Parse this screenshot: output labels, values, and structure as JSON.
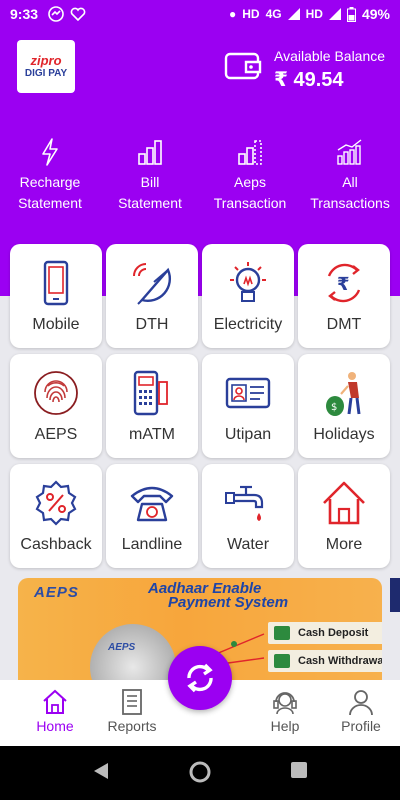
{
  "status_bar": {
    "time": "9:33",
    "network": "HD",
    "network2": "4G",
    "network3": "HD",
    "battery": "49%"
  },
  "header": {
    "logo_line1": "zipro",
    "logo_line2": "DIGI PAY",
    "balance_label": "Available Balance",
    "balance_amount": "₹ 49.54"
  },
  "quick_actions": [
    {
      "line1": "Recharge",
      "line2": "Statement",
      "icon": "bolt-icon"
    },
    {
      "line1": "Bill",
      "line2": "Statement",
      "icon": "bar-chart-icon"
    },
    {
      "line1": "Aeps",
      "line2": "Transaction",
      "icon": "bar-chart-icon"
    },
    {
      "line1": "All",
      "line2": "Transactions",
      "icon": "trend-chart-icon"
    }
  ],
  "services": [
    {
      "label": "Mobile",
      "icon": "mobile-icon"
    },
    {
      "label": "DTH",
      "icon": "satellite-dish-icon"
    },
    {
      "label": "Electricity",
      "icon": "bulb-icon"
    },
    {
      "label": "DMT",
      "icon": "rupee-transfer-icon"
    },
    {
      "label": "AEPS",
      "icon": "fingerprint-icon"
    },
    {
      "label": "mATM",
      "icon": "pos-machine-icon"
    },
    {
      "label": "Utipan",
      "icon": "id-card-icon"
    },
    {
      "label": "Holidays",
      "icon": "holidays-icon"
    },
    {
      "label": "Cashback",
      "icon": "percent-badge-icon"
    },
    {
      "label": "Landline",
      "icon": "telephone-icon"
    },
    {
      "label": "Water",
      "icon": "water-tap-icon"
    },
    {
      "label": "More",
      "icon": "house-icon"
    }
  ],
  "banner": {
    "logo": "AEPS",
    "title_line1": "Aadhaar Enable",
    "title_line2": "Payment System",
    "disc_label": "AEPS",
    "pills": [
      "Cash Deposit",
      "Cash Withdrawal"
    ]
  },
  "bottom_nav": [
    {
      "label": "Home",
      "icon": "home-icon",
      "active": true
    },
    {
      "label": "Reports",
      "icon": "reports-icon",
      "active": false
    },
    {
      "label": "Help",
      "icon": "headset-icon",
      "active": false
    },
    {
      "label": "Profile",
      "icon": "person-icon",
      "active": false
    }
  ],
  "colors": {
    "primary": "#9b00f2",
    "icon_blue": "#2a3f9a",
    "icon_red": "#e0252b"
  }
}
